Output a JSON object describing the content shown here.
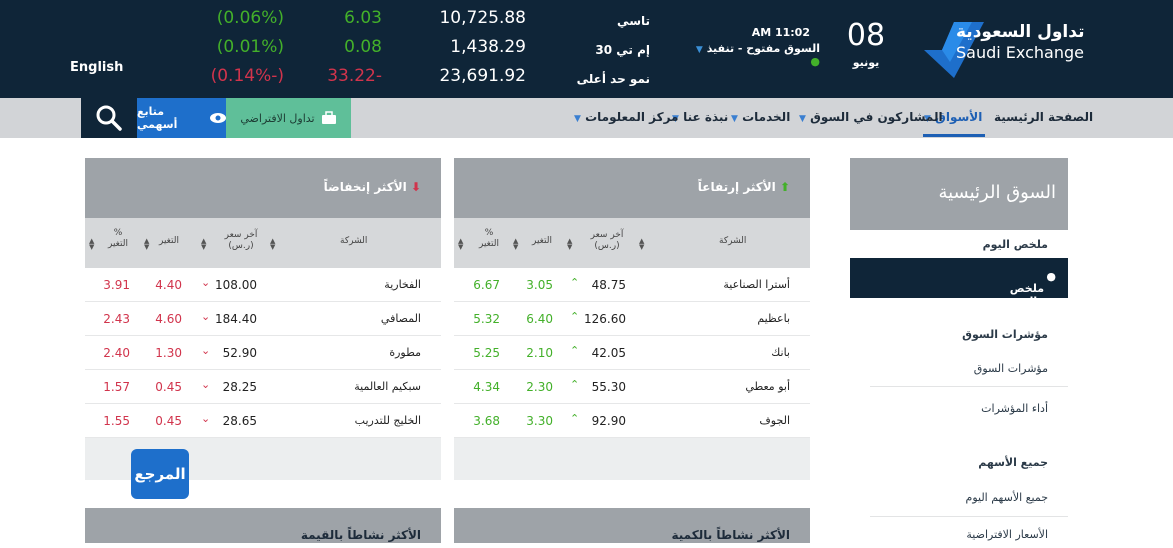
{
  "ticker": [
    {
      "pct": "(0.06%)",
      "change": "6.03",
      "value": "10,725.88",
      "index": "تاسي",
      "dir": "up"
    },
    {
      "pct": "(0.01%)",
      "change": "0.08",
      "value": "1,438.29",
      "index": "إم تي 30",
      "dir": "up"
    },
    {
      "pct": "(0.14%-)",
      "change": "33.22-",
      "value": "23,691.92",
      "index": "نمو حد أعلى",
      "dir": "down"
    }
  ],
  "header": {
    "language": "English",
    "time": "AM 11:02",
    "market_status": "السوق مفتوح - تنفيذ",
    "day": "08",
    "month": "يونيو",
    "logo_ar": "تداول السعودية",
    "logo_en": "Saudi Exchange"
  },
  "nav": {
    "items": [
      "الصفحة الرئيسية",
      "الأسواق",
      "المشاركون في السوق",
      "الخدمات",
      "نبذة عنا",
      "مركز المعلومات"
    ],
    "virtual_trading": "تداول الافتراضي",
    "watchlist": "متابع أسهمي"
  },
  "columns": {
    "company": "الشركة",
    "last_price": "آخر سعر",
    "last_price_unit": "(ر.س)",
    "change": "التغير",
    "pct": "%",
    "pct_label": "التغير"
  },
  "gainers": {
    "title": "الأكثر إرتفاعاً",
    "rows": [
      {
        "name": "أسترا الصناعية",
        "price": "48.75",
        "change": "3.05",
        "pct": "6.67"
      },
      {
        "name": "باعظيم",
        "price": "126.60",
        "change": "6.40",
        "pct": "5.32"
      },
      {
        "name": "بانك",
        "price": "42.05",
        "change": "2.10",
        "pct": "5.25"
      },
      {
        "name": "أبو معطي",
        "price": "55.30",
        "change": "2.30",
        "pct": "4.34"
      },
      {
        "name": "الجوف",
        "price": "92.90",
        "change": "3.30",
        "pct": "3.68"
      }
    ]
  },
  "losers": {
    "title": "الأكثر إنخفاضاً",
    "rows": [
      {
        "name": "الفخارية",
        "price": "108.00",
        "change": "4.40",
        "pct": "3.91"
      },
      {
        "name": "المصافي",
        "price": "184.40",
        "change": "4.60",
        "pct": "2.43"
      },
      {
        "name": "مطورة",
        "price": "52.90",
        "change": "1.30",
        "pct": "2.40"
      },
      {
        "name": "سبكيم العالمية",
        "price": "28.25",
        "change": "0.45",
        "pct": "1.57"
      },
      {
        "name": "الخليج للتدريب",
        "price": "28.65",
        "change": "0.45",
        "pct": "1.55"
      }
    ]
  },
  "bottom_panels": {
    "by_value": "الأكثر نشاطاً بالقيمة",
    "by_volume": "الأكثر نشاطاً بالكمية"
  },
  "sidebar": {
    "title": "السوق الرئيسية",
    "summary_group": "ملخص اليوم",
    "summary_item": "ملخص اليوم",
    "indices_group": "مؤشرات السوق",
    "indices_item": "مؤشرات السوق",
    "indices_performance": "أداء المؤشرات",
    "stocks_group": "جميع الأسهم",
    "stocks_item": "جميع الأسهم اليوم",
    "virtual_prices": "الأسعار الافتراضية"
  },
  "watermark": "المرجع",
  "colors": {
    "header_bg": "#0f2538",
    "up": "#43b02a",
    "down": "#d1344c",
    "accent": "#1e6fcb",
    "panel_head": "#9ea3a8"
  }
}
